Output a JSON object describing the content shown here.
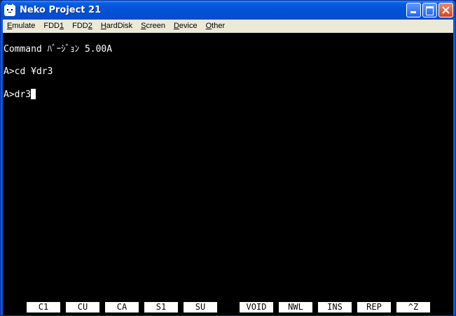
{
  "window": {
    "title": "Neko Project 21",
    "icon": "cat-icon"
  },
  "menu": [
    {
      "name": "emulate",
      "label_prefix": "",
      "mnemonic": "E",
      "label_suffix": "mulate"
    },
    {
      "name": "fdd1",
      "label_prefix": "FDD",
      "mnemonic": "1",
      "label_suffix": ""
    },
    {
      "name": "fdd2",
      "label_prefix": "FDD",
      "mnemonic": "2",
      "label_suffix": ""
    },
    {
      "name": "harddisk",
      "label_prefix": "",
      "mnemonic": "H",
      "label_suffix": "ardDisk"
    },
    {
      "name": "screen",
      "label_prefix": "",
      "mnemonic": "S",
      "label_suffix": "creen"
    },
    {
      "name": "device",
      "label_prefix": "",
      "mnemonic": "D",
      "label_suffix": "evice"
    },
    {
      "name": "other",
      "label_prefix": "",
      "mnemonic": "O",
      "label_suffix": "ther"
    }
  ],
  "console": {
    "lines": [
      "Command ﾊﾞｰｼﾞｮﾝ 5.00A",
      "A>cd ¥dr3",
      "A>dr3"
    ]
  },
  "function_keys": [
    "C1",
    "CU",
    "CA",
    "S1",
    "SU",
    "VOID",
    "NWL",
    "INS",
    "REP",
    "^Z"
  ]
}
